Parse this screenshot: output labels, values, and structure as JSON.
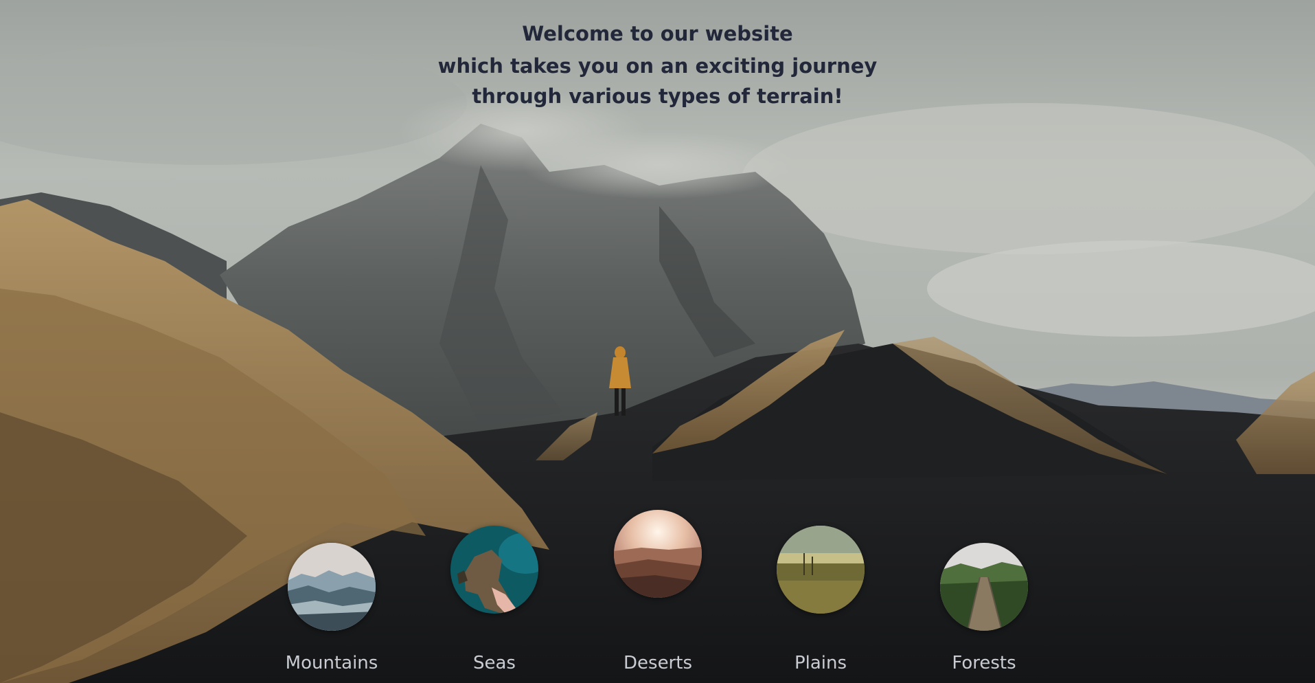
{
  "hero": {
    "line1": "Welcome to our website",
    "line2": "which takes you on an exciting journey through various types of terrain!"
  },
  "terrains": [
    {
      "label": "Mountains",
      "icon": "mountains-thumbnail"
    },
    {
      "label": "Seas",
      "icon": "seas-thumbnail"
    },
    {
      "label": "Deserts",
      "icon": "deserts-thumbnail"
    },
    {
      "label": "Plains",
      "icon": "plains-thumbnail"
    },
    {
      "label": "Forests",
      "icon": "forests-thumbnail"
    }
  ],
  "colors": {
    "heading": "#22283a",
    "label": "#c9cdd3",
    "sky": "#b9bcb8",
    "ground": "#1a1b1d"
  }
}
